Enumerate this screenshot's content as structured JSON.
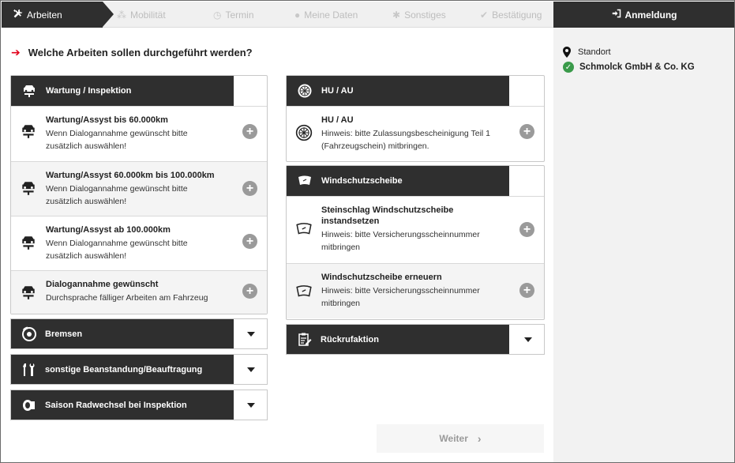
{
  "steps": {
    "active": "Arbeiten",
    "items": [
      "Mobilität",
      "Termin",
      "Meine Daten",
      "Sonstiges",
      "Bestätigung"
    ],
    "login": "Anmeldung"
  },
  "question": "Welche Arbeiten sollen durchgeführt werden?",
  "location": {
    "label": "Standort",
    "name": "Schmolck GmbH & Co. KG"
  },
  "left": {
    "wartung": {
      "title": "Wartung / Inspektion",
      "items": [
        {
          "title": "Wartung/Assyst bis 60.000km",
          "sub1": "Wenn Dialogannahme gewünscht bitte",
          "sub2": "zusätzlich auswählen!"
        },
        {
          "title": "Wartung/Assyst 60.000km bis 100.000km",
          "sub1": "Wenn Dialogannahme gewünscht bitte",
          "sub2": "zusätzlich auswählen!"
        },
        {
          "title": "Wartung/Assyst ab 100.000km",
          "sub1": "Wenn Dialogannahme gewünscht bitte",
          "sub2": "zusätzlich auswählen!"
        },
        {
          "title": "Dialogannahme gewünscht",
          "sub1": "Durchsprache fälliger Arbeiten am Fahrzeug",
          "sub2": ""
        }
      ]
    },
    "collapsed": [
      {
        "title": "Bremsen"
      },
      {
        "title": "sonstige Beanstandung/Beauftragung"
      },
      {
        "title": "Saison Radwechsel bei Inspektion"
      }
    ]
  },
  "right": {
    "hu": {
      "title": "HU / AU",
      "item": {
        "title": "HU / AU",
        "sub1": "Hinweis: bitte Zulassungsbescheinigung Teil 1",
        "sub2": "(Fahrzeugschein) mitbringen."
      }
    },
    "wind": {
      "title": "Windschutzscheibe",
      "items": [
        {
          "title1": "Steinschlag Windschutzscheibe",
          "title2": "instandsetzen",
          "sub1": "Hinweis: bitte Versicherungsscheinnummer",
          "sub2": "mitbringen"
        },
        {
          "title1": "Windschutzscheibe erneuern",
          "title2": "",
          "sub1": "Hinweis: bitte Versicherungsscheinnummer",
          "sub2": "mitbringen"
        }
      ]
    },
    "rueckruf": {
      "title": "Rückrufaktion"
    }
  },
  "next_label": "Weiter",
  "colors": {
    "dark": "#2f2f2f",
    "accent": "#e2001a",
    "check": "#3a9a4a"
  }
}
